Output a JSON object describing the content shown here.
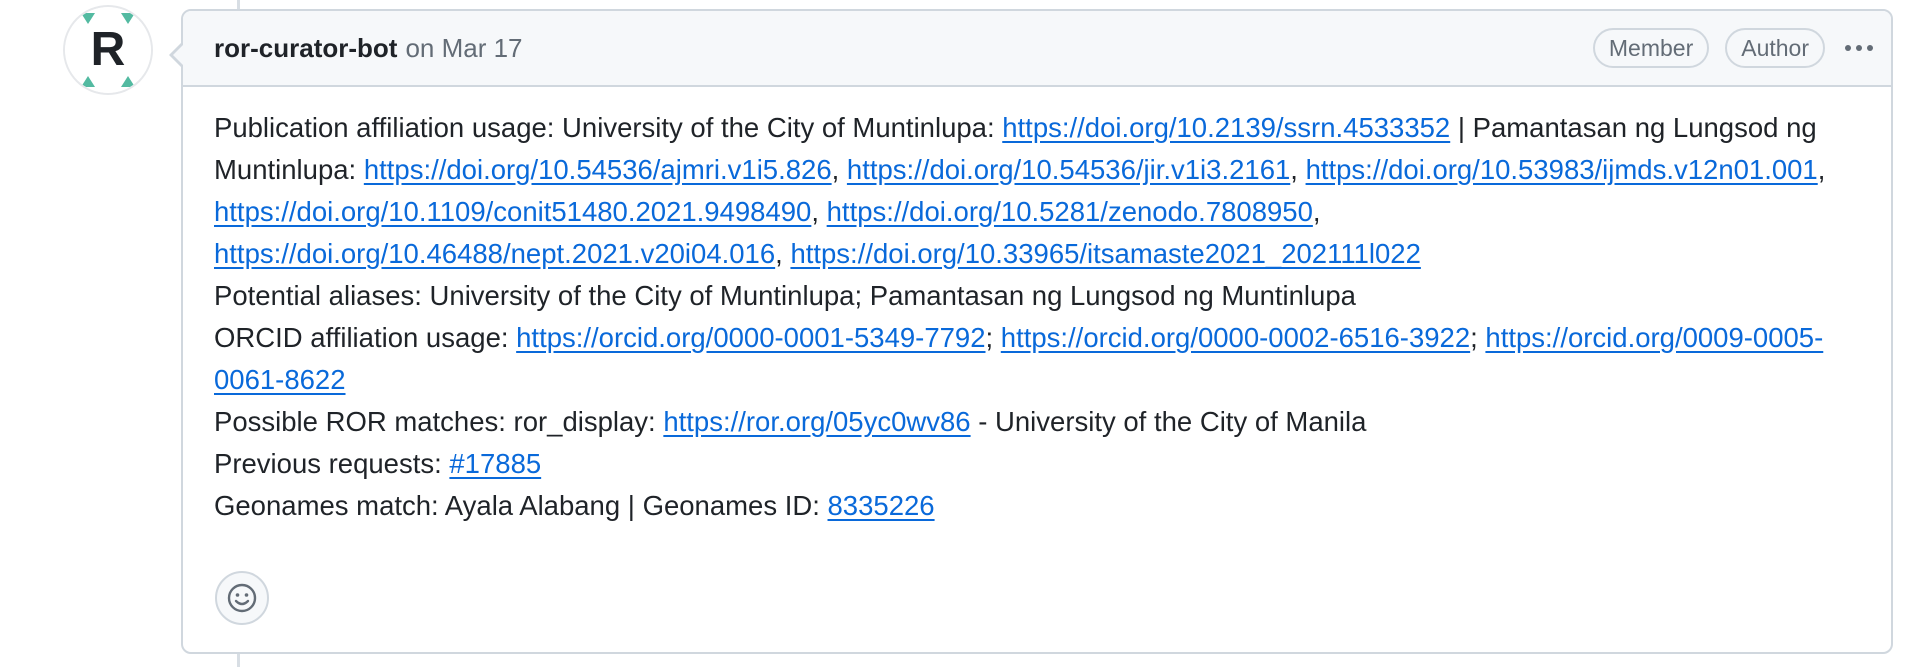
{
  "comment": {
    "author": "ror-curator-bot",
    "date": "on Mar 17",
    "badges": [
      "Member",
      "Author"
    ],
    "avatar_letter": "R"
  },
  "body": {
    "pub_label": "Publication affiliation usage: University of the City of Muntinlupa: ",
    "pub_link_1": "https://doi.org/10.2139/ssrn.4533352",
    "pub_sep_1": " | Pamantasan ng Lungsod ng Muntinlupa: ",
    "pub_link_2": "https://doi.org/10.54536/ajmri.v1i5.826",
    "pub_link_3": "https://doi.org/10.54536/jir.v1i3.2161",
    "pub_link_4": "https://doi.org/10.53983/ijmds.v12n01.001",
    "pub_link_5": "https://doi.org/10.1109/conit51480.2021.9498490",
    "pub_link_6": "https://doi.org/10.5281/zenodo.7808950",
    "pub_link_7": "https://doi.org/10.46488/nept.2021.v20i04.016",
    "pub_link_8": "https://doi.org/10.33965/itsamaste2021_202111l022",
    "comma": ", ",
    "semicolon": "; ",
    "aliases": "Potential aliases: University of the City of Muntinlupa; Pamantasan ng Lungsod ng Muntinlupa",
    "orcid_label": "ORCID affiliation usage: ",
    "orcid_link_1": "https://orcid.org/0000-0001-5349-7792",
    "orcid_link_2": "https://orcid.org/0000-0002-6516-3922",
    "orcid_link_3": "https://orcid.org/0009-0005-0061-8622",
    "ror_label": "Possible ROR matches: ror_display: ",
    "ror_link": "https://ror.org/05yc0wv86",
    "ror_suffix": " - University of the City of Manila",
    "prev_label": "Previous requests: ",
    "prev_link": "#17885",
    "geo_label": "Geonames match: Ayala Alabang | Geonames ID: ",
    "geo_link": "8335226"
  },
  "icons": {
    "avatar": "ror-logo-icon",
    "menu": "kebab-horizontal-icon",
    "reaction": "smiley-icon"
  },
  "colors": {
    "link": "#0969da",
    "muted": "#636c76",
    "border": "#d0d7de",
    "header_bg": "#f6f8fa",
    "avatar_accent": "#53baa1"
  }
}
